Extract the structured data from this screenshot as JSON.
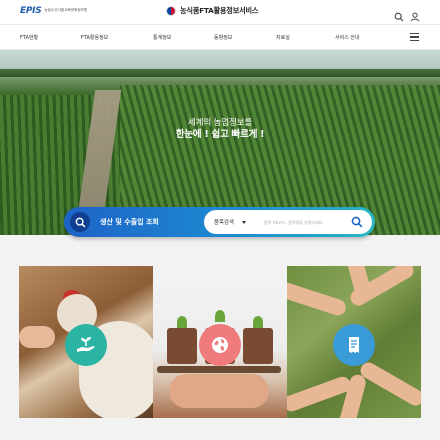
{
  "header": {
    "logo_text": "EPIS",
    "logo_subtext": "농림수산식품교육문화정보원",
    "site_title": "농식품FTA활용정보서비스",
    "search_icon": "search-icon",
    "user_icon": "user-icon"
  },
  "nav": {
    "items": [
      {
        "label": "FTA현황"
      },
      {
        "label": "FTA활용정보"
      },
      {
        "label": "통계정보"
      },
      {
        "label": "동향정보"
      },
      {
        "label": "자료실"
      },
      {
        "label": "서비스 안내"
      }
    ],
    "menu_icon": "hamburger-menu-icon"
  },
  "hero": {
    "line1": "세계의 농업정보를",
    "line2": "한눈에 ! 쉽고 빠르게 !"
  },
  "search": {
    "title": "생산 및 수출입 조회",
    "category": "품목검색",
    "placeholder": "품목 HS코드, 품목명을 입력하세요"
  },
  "cards": [
    {
      "icon": "plant-hand-icon",
      "color": "#2bb3a3"
    },
    {
      "icon": "globe-icon",
      "color": "#ef7b7d"
    },
    {
      "icon": "document-icon",
      "color": "#3a9bd9"
    }
  ],
  "colors": {
    "brand_blue": "#1f5fb0",
    "search_gradient_start": "#1e63c7",
    "search_gradient_end": "#2ab6c3"
  }
}
